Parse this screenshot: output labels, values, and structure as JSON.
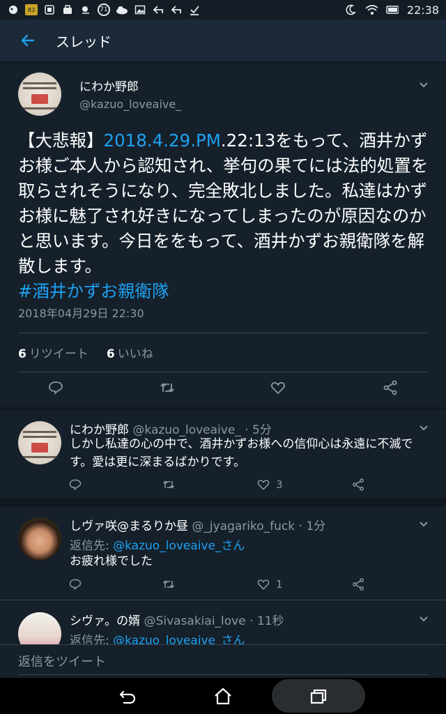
{
  "status_bar": {
    "time": "22:38",
    "battery_badge": "83",
    "notification_badge": "71"
  },
  "app_bar": {
    "title": "スレッド"
  },
  "main_tweet": {
    "name": "にわか野郎",
    "handle": "@kazuo_loveaive_",
    "text_prefix": "【大悲報】",
    "text_link": "2018.4.29.PM",
    "text_body": ".22:13をもって、酒井かずお様ご本人から認知され、挙句の果てには法的処置を取らされそうになり、完全敗北しました。私達はかずお様に魅了され好きになってしまったのが原因なのかと思います。今日ををもって、酒井かずお親衛隊を解散します。",
    "hashtag": "#酒井かずお親衛隊",
    "timestamp": "2018年04月29日 22:30",
    "retweet_count": "6",
    "retweet_label": "リツイート",
    "like_count": "6",
    "like_label": "いいね"
  },
  "replies": [
    {
      "name": "にわか野郎",
      "meta": "@kazuo_loveaive_ · 5分",
      "text": "しかし私達の心の中で、酒井かずお様への信仰心は永遠に不滅です。愛は更に深まるばかりです。",
      "like_count": "3"
    },
    {
      "name": "しヴァ咲@まるりか昼",
      "meta": "@_jyagariko_fuck · 1分",
      "reply_to_label": "返信先: ",
      "reply_to_link": "@kazuo_loveaive_さん",
      "text": "お疲れ様でした",
      "like_count": "1"
    },
    {
      "name": "シヴァ。の婿",
      "meta": "@Sivasakiai_love · 11秒",
      "reply_to_label": "返信先: ",
      "reply_to_link": "@kazuo_loveaive_さん"
    }
  ],
  "composer": {
    "placeholder": "返信をツイート"
  },
  "colors": {
    "accent": "#1da1f2",
    "background": "#15202b",
    "secondary_text": "#8899a6"
  }
}
